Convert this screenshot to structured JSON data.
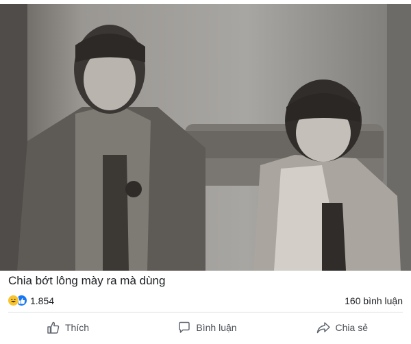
{
  "post": {
    "photo_description_icon": "photo-image",
    "caption": "Chia bớt lông mày ra mà dùng"
  },
  "stats": {
    "reaction_icons": [
      "haha-reaction-icon",
      "like-reaction-icon"
    ],
    "reaction_count": "1.854",
    "comment_count": "160 bình luận"
  },
  "actions": {
    "like_label": "Thích",
    "comment_label": "Bình luận",
    "share_label": "Chia sẻ"
  },
  "colors": {
    "like_blue": "#1877f2",
    "haha_yellow": "#f7c531",
    "action_gray": "#4b4f56",
    "divider": "#dadde1"
  }
}
